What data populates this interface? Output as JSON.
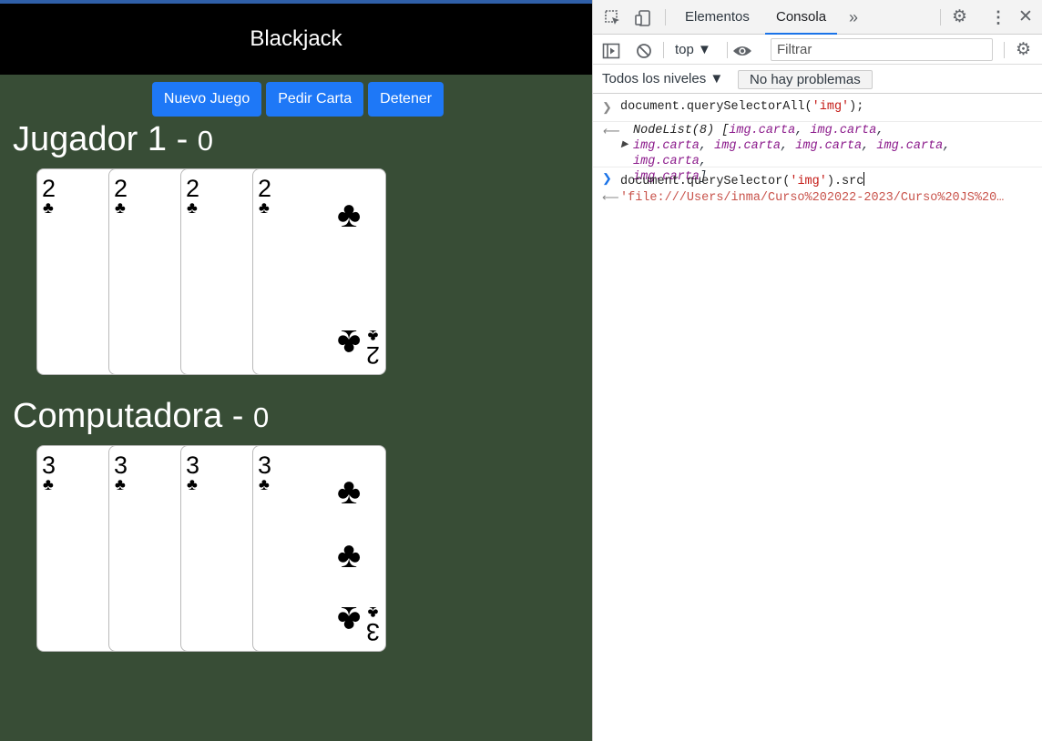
{
  "game": {
    "title": "Blackjack",
    "buttons": {
      "new_game": "Nuevo Juego",
      "hit": "Pedir Carta",
      "stand": "Detener"
    },
    "players": [
      {
        "name": "Jugador 1 - ",
        "score": "0",
        "cards": [
          {
            "rank": "2",
            "suit": "♣"
          },
          {
            "rank": "2",
            "suit": "♣"
          },
          {
            "rank": "2",
            "suit": "♣"
          },
          {
            "rank": "2",
            "suit": "♣"
          }
        ]
      },
      {
        "name": "Computadora - ",
        "score": "0",
        "cards": [
          {
            "rank": "3",
            "suit": "♣"
          },
          {
            "rank": "3",
            "suit": "♣"
          },
          {
            "rank": "3",
            "suit": "♣"
          },
          {
            "rank": "3",
            "suit": "♣"
          }
        ]
      }
    ],
    "colors": {
      "table": "#384d36",
      "header": "#000000",
      "button": "#1e78f7"
    }
  },
  "devtools": {
    "tabs": {
      "elements": "Elementos",
      "console": "Consola",
      "more": "»"
    },
    "toolbar": {
      "context": "top ▼",
      "filter_placeholder": "Filtrar"
    },
    "levels": {
      "label": "Todos los niveles ▼",
      "issues": "No hay problemas"
    },
    "console": {
      "input1": "document.querySelectorAll(",
      "input1_arg": "'img'",
      "input1_end": ");",
      "output1_head": "NodeList(8) [",
      "output1_items": [
        "img.carta",
        "img.carta",
        "img.carta",
        "img.carta",
        "img.carta",
        "img.carta",
        "img.carta",
        "img.carta"
      ],
      "input2": "document.querySelector(",
      "input2_arg": "'img'",
      "input2_end": ").src",
      "output2": "'file:///Users/inma/Curso%202022-2023/Curso%20JS%20…"
    }
  }
}
